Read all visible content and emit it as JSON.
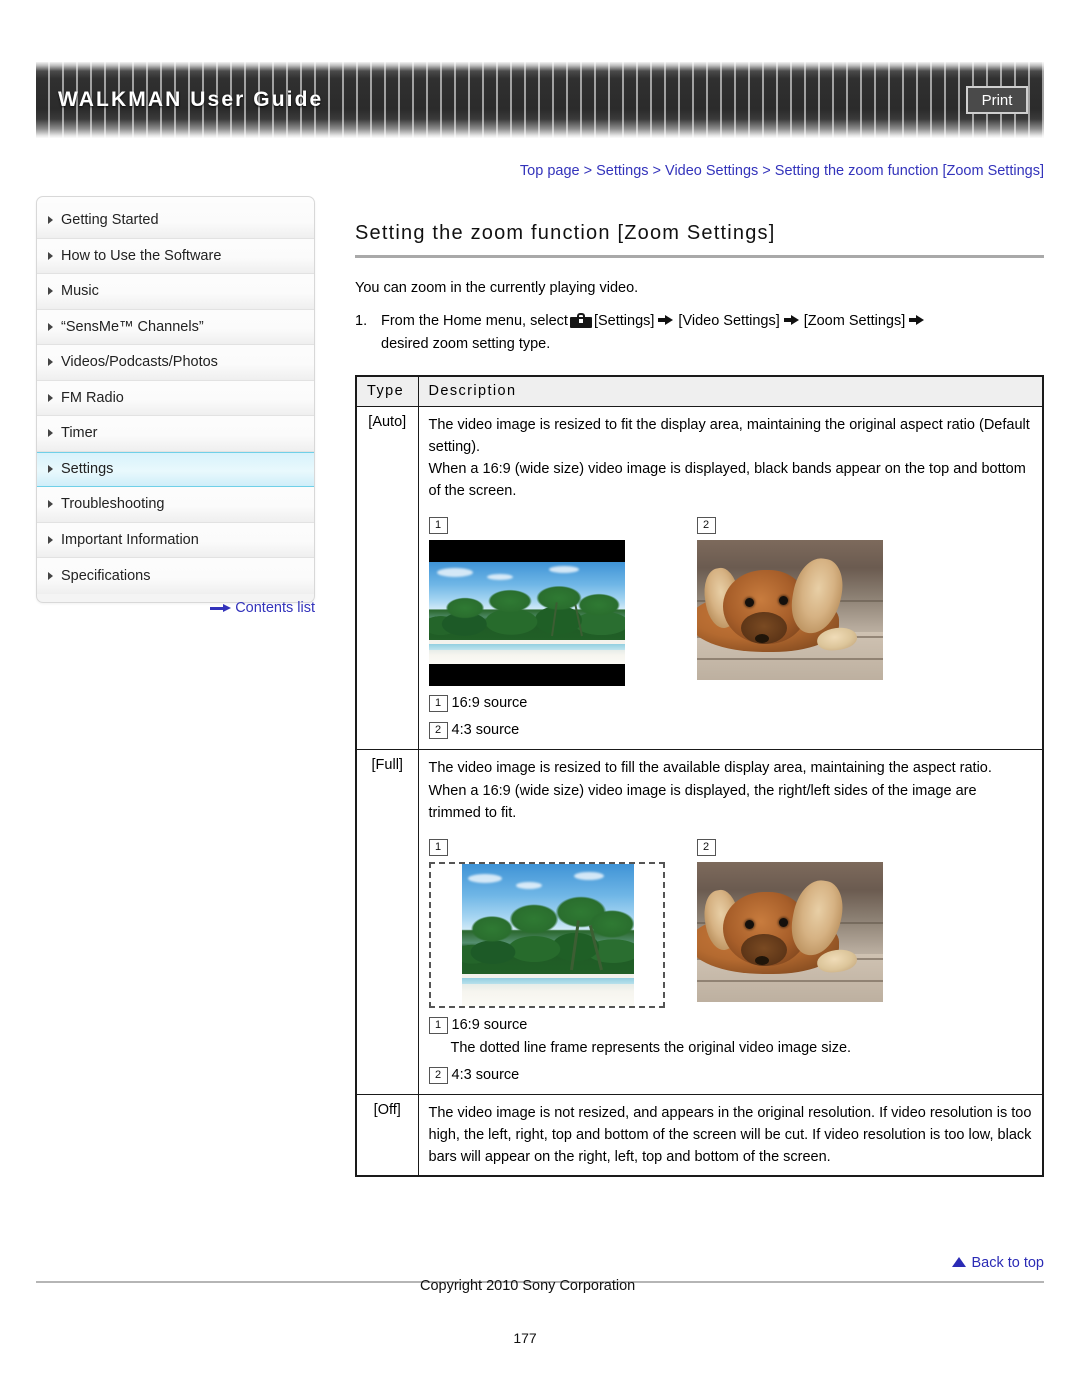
{
  "header": {
    "title": "WALKMAN User Guide",
    "print_label": "Print"
  },
  "breadcrumb": {
    "items": [
      "Top page",
      "Settings",
      "Video Settings",
      "Setting the zoom function [Zoom Settings]"
    ],
    "separator": ">",
    "full_text": "Top page > Settings > Video Settings > Setting the zoom function [Zoom Settings]"
  },
  "sidebar": {
    "items": [
      {
        "label": "Getting Started",
        "selected": false
      },
      {
        "label": "How to Use the Software",
        "selected": false
      },
      {
        "label": "Music",
        "selected": false
      },
      {
        "label": "“SensMe™ Channels”",
        "selected": false
      },
      {
        "label": "Videos/Podcasts/Photos",
        "selected": false
      },
      {
        "label": "FM Radio",
        "selected": false
      },
      {
        "label": "Timer",
        "selected": false
      },
      {
        "label": "Settings",
        "selected": true
      },
      {
        "label": "Troubleshooting",
        "selected": false
      },
      {
        "label": "Important Information",
        "selected": false
      },
      {
        "label": "Specifications",
        "selected": false
      }
    ],
    "contents_list_label": "Contents list"
  },
  "main": {
    "page_title": "Setting the zoom function [Zoom Settings]",
    "intro": "You can zoom in the currently playing video.",
    "step": {
      "number": "1.",
      "part1": "From the Home menu, select",
      "settings_label": "[Settings]",
      "video_settings_label": "[Video Settings]",
      "zoom_settings_label": "[Zoom Settings]",
      "part2": "desired zoom setting type."
    },
    "table": {
      "headers": {
        "type": "Type",
        "description": "Description"
      },
      "rows": [
        {
          "type": "[Auto]",
          "desc_lines": [
            "The video image is resized to fit the display area, maintaining the original aspect ratio (Default setting).",
            "When a 16:9 (wide size) video image is displayed, black bands appear on the top and bottom of the screen."
          ],
          "figure_labels": {
            "first": "1",
            "second": "2"
          },
          "captions": [
            {
              "badge": "1",
              "text": "16:9 source"
            },
            {
              "badge": "2",
              "text": "4:3 source"
            }
          ]
        },
        {
          "type": "[Full]",
          "desc_lines": [
            "The video image is resized to fill the available display area, maintaining the aspect ratio.",
            "When a 16:9 (wide size) video image is displayed, the right/left sides of the image are trimmed to fit."
          ],
          "figure_labels": {
            "first": "1",
            "second": "2"
          },
          "captions": [
            {
              "badge": "1",
              "text": "16:9 source"
            },
            {
              "badge": "",
              "text": "The dotted line frame represents the original video image size."
            },
            {
              "badge": "2",
              "text": "4:3 source"
            }
          ]
        },
        {
          "type": "[Off]",
          "desc_lines": [
            "The video image is not resized, and appears in the original resolution. If video resolution is too high, the left, right, top and bottom of the screen will be cut. If video resolution is too low, black bars will appear on the right, left, top and bottom of the screen."
          ],
          "figure_labels": null,
          "captions": []
        }
      ]
    }
  },
  "footer": {
    "back_to_top": "Back to top",
    "copyright": "Copyright 2010 Sony Corporation",
    "page_number": "177"
  },
  "colors": {
    "link": "#3333bb",
    "selected_nav_bg": "#dff5fc",
    "selected_nav_border": "#6fd0e8",
    "table_header_bg": "#efefef",
    "rule": "#a9a9a9"
  }
}
